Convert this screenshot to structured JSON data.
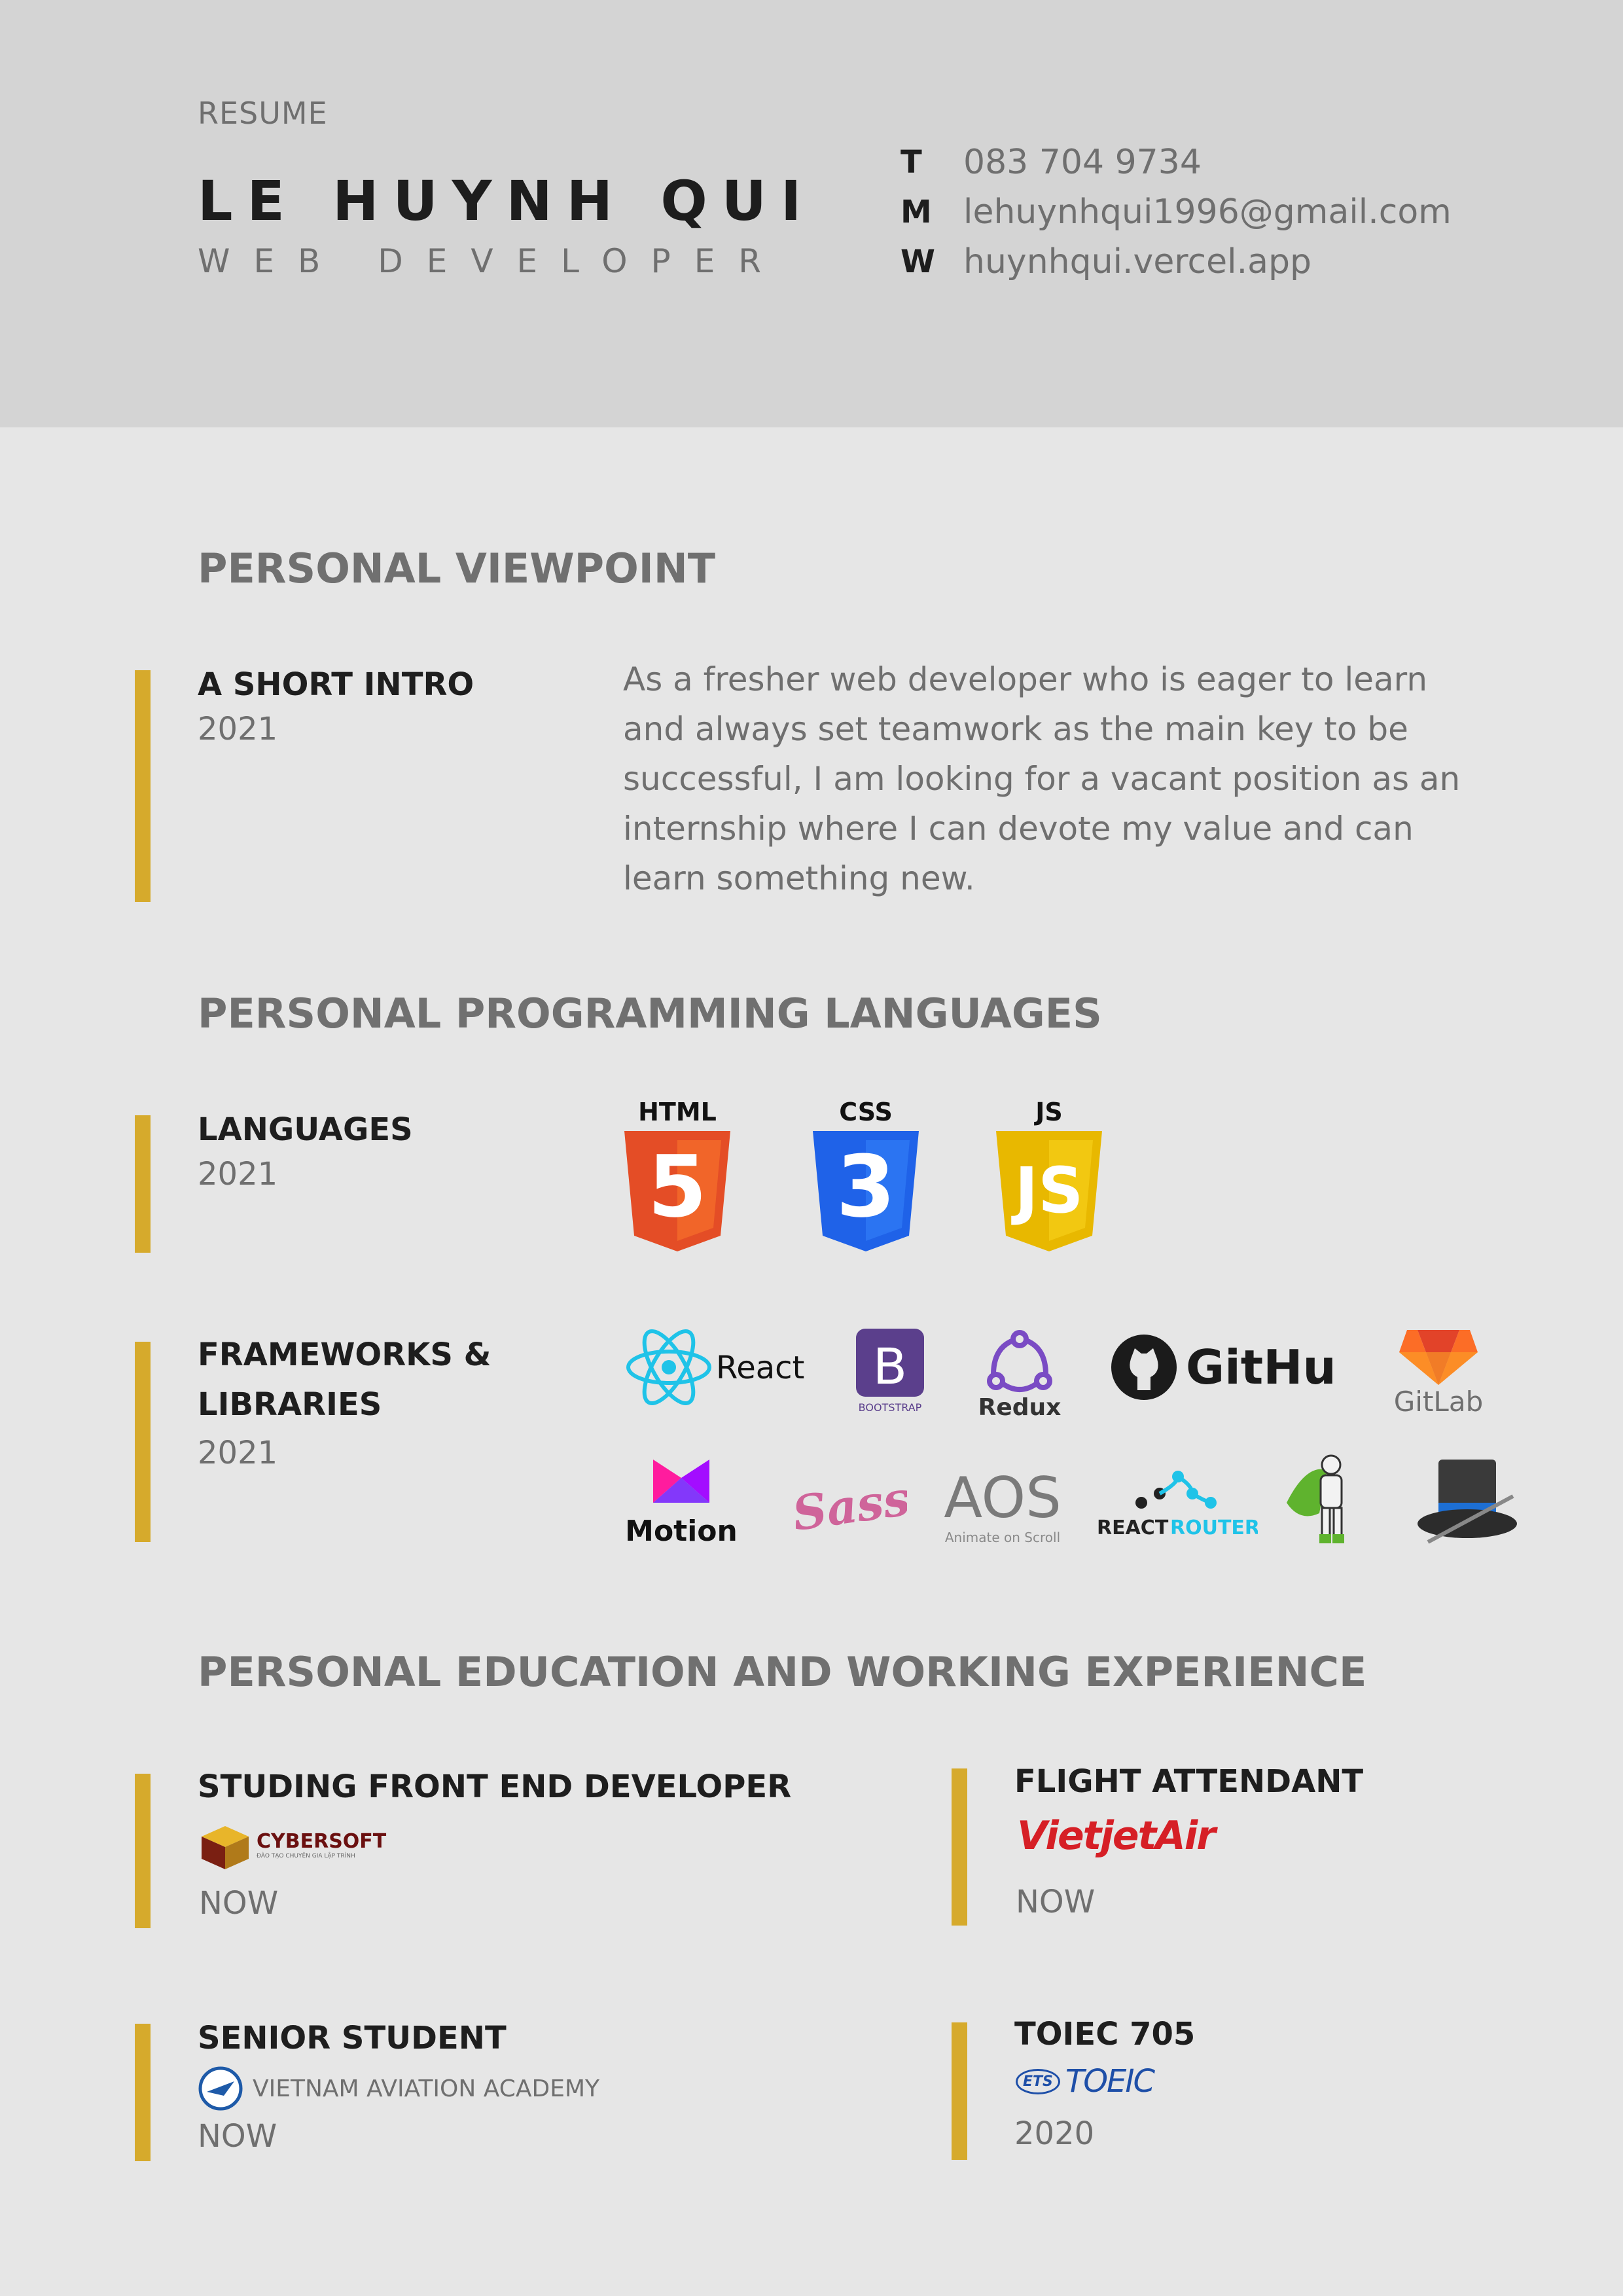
{
  "header": {
    "resume_label": "RESUME",
    "name": "LE HUYNH QUI",
    "role": "WEB DEVELOPER",
    "contacts": [
      {
        "key": "T",
        "value": "083 704 9734"
      },
      {
        "key": "M",
        "value": "lehuynhqui1996@gmail.com"
      },
      {
        "key": "W",
        "value": "huynhqui.vercel.app"
      }
    ]
  },
  "viewpoint": {
    "section_title": "PERSONAL VIEWPOINT",
    "title": "A SHORT INTRO",
    "year": "2021",
    "text": "As a fresher web developer who is eager to learn and always set teamwork as the main key to be successful, I am looking for a vacant position as an internship where I can devote my value and can learn something new."
  },
  "programming": {
    "section_title": "PERSONAL PROGRAMMING LANGUAGES",
    "languages": {
      "title": "LANGUAGES",
      "year": "2021",
      "logos": [
        {
          "label": "HTML",
          "digit": "5",
          "color": "#e44d26",
          "icon": "html5-icon"
        },
        {
          "label": "CSS",
          "digit": "3",
          "color": "#1f62e8",
          "icon": "css3-icon"
        },
        {
          "label": "JS",
          "digit": "JS",
          "color": "#e8b800",
          "icon": "js-icon"
        }
      ]
    },
    "frameworks": {
      "title_line1": "FRAMEWORKS &",
      "title_line2": "LIBRARIES",
      "year": "2021",
      "react": "React",
      "bootstrap_letter": "B",
      "bootstrap": "BOOTSTRAP",
      "redux": "Redux",
      "github": "GitHub",
      "gitlab": "GitLab",
      "motion": "Motion",
      "sass": "Sass",
      "aos": "AOS",
      "aos_sub": "Animate on Scroll",
      "router_1": "REACT",
      "router_2": "ROUTER"
    }
  },
  "experience": {
    "section_title": "PERSONAL EDUCATION AND WORKING EXPERIENCE",
    "items": [
      {
        "title": "STUDING FRONT END DEVELOPER",
        "org": "CYBERSOFT",
        "org_sub": "ĐÀO TẠO CHUYÊN GIA LẬP TRÌNH",
        "period": "NOW"
      },
      {
        "title": "FLIGHT ATTENDANT",
        "org": "VietjetAir",
        "period": "NOW"
      },
      {
        "title": "SENIOR STUDENT",
        "org": "VIETNAM AVIATION ACADEMY",
        "period": "NOW"
      },
      {
        "title": "TOIEC 705",
        "org_prefix": "ETS",
        "org": "TOEIC",
        "period": "2020"
      }
    ]
  },
  "colors": {
    "accent": "#d6aa2c",
    "header_bg": "#d4d4d4",
    "page_bg": "#e6e6e6"
  }
}
